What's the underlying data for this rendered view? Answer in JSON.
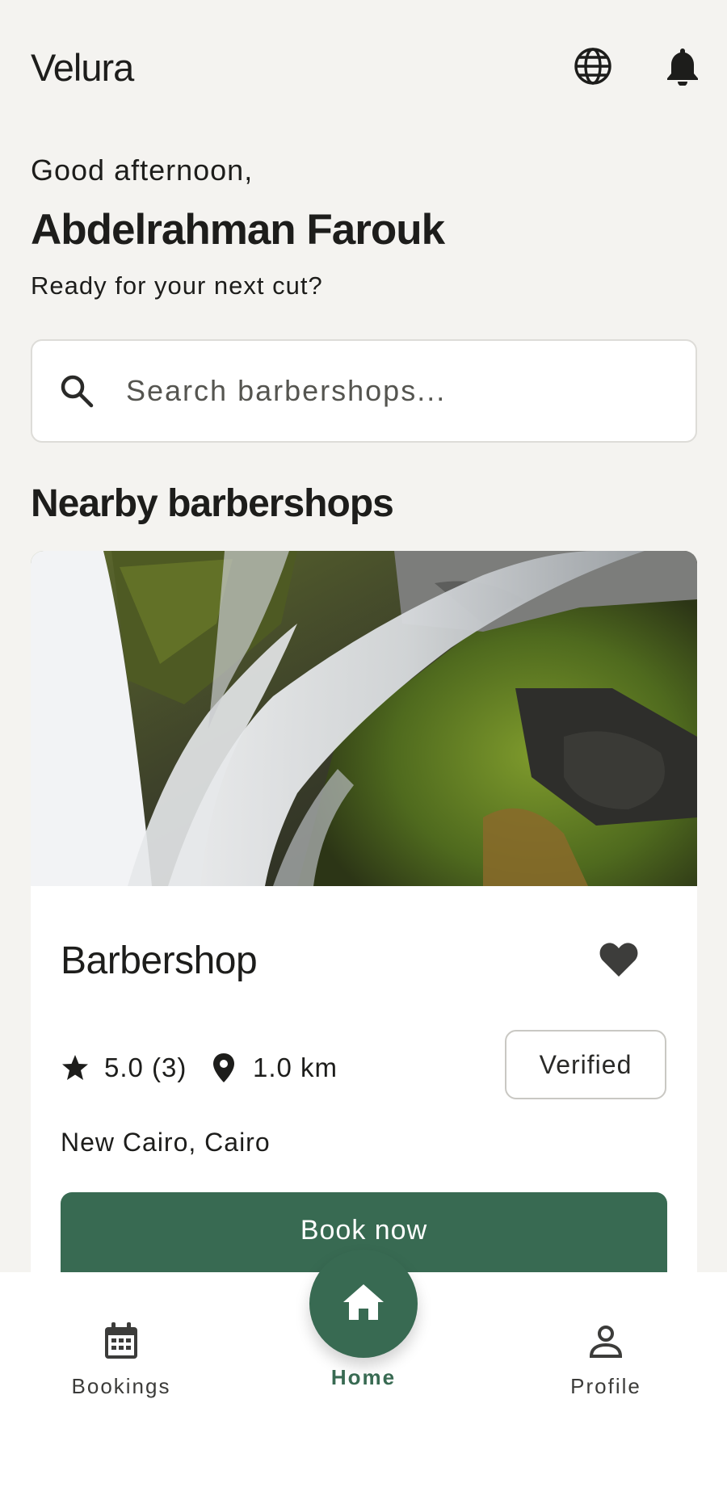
{
  "header": {
    "app_title": "Velura",
    "icons": [
      "globe-icon",
      "bell-icon"
    ]
  },
  "welcome": {
    "greeting": "Good afternoon,",
    "user_name": "Abdelrahman Farouk",
    "subline": "Ready for your next cut?"
  },
  "search": {
    "placeholder": "Search barbershops...",
    "value": ""
  },
  "nearby": {
    "section_title": "Nearby barbershops",
    "shops": [
      {
        "name": "Barbershop",
        "rating": "5.0 (3)",
        "distance": "1.0 km",
        "badge": "Verified",
        "location": "New Cairo, Cairo",
        "cta": "Book now",
        "favorited": true
      }
    ]
  },
  "bottom_nav": {
    "items": [
      {
        "label": "Bookings",
        "icon": "calendar-icon"
      },
      {
        "label": "Home",
        "icon": "home-icon",
        "active": true
      },
      {
        "label": "Profile",
        "icon": "person-icon"
      }
    ]
  },
  "colors": {
    "accent": "#386a52",
    "background": "#f4f3f0"
  }
}
